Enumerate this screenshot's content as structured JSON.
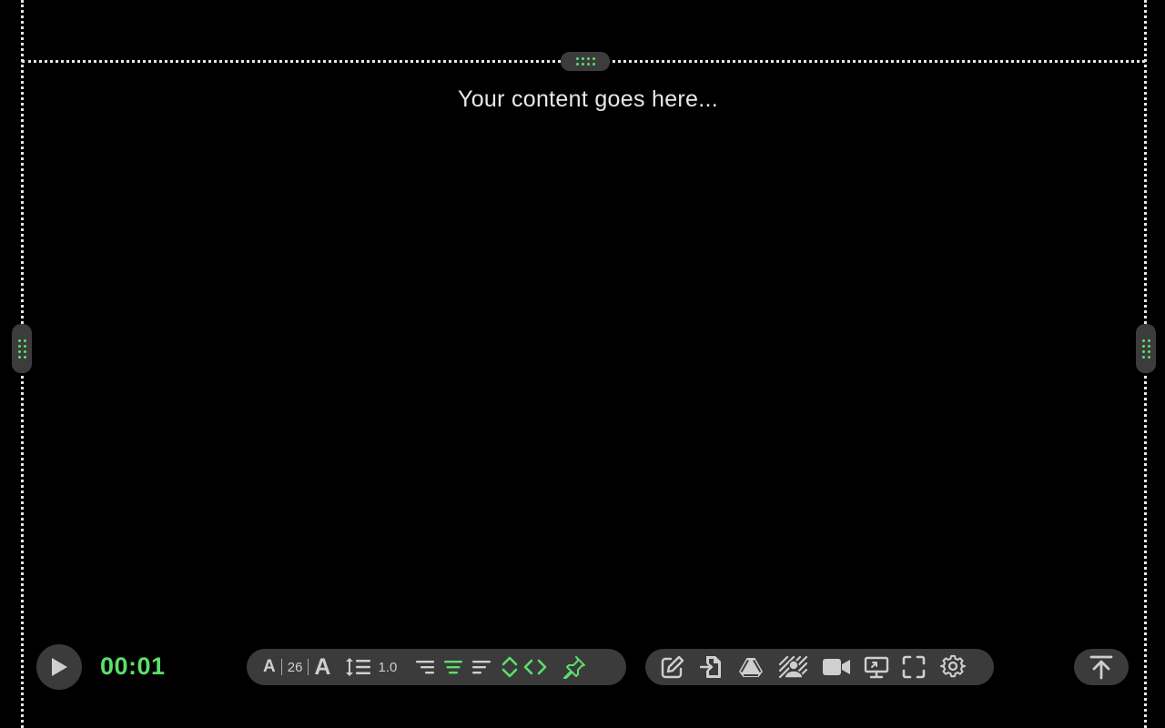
{
  "canvas": {
    "placeholder_text": "Your content goes here..."
  },
  "player": {
    "play_icon": "play-icon",
    "timer": "00:01"
  },
  "format_toolbar": {
    "font_decrease_label": "A",
    "font_size": "26",
    "font_increase_label": "A",
    "line_height_icon": "line-height-icon",
    "line_height": "1.0",
    "align_right_icon": "align-right-icon",
    "align_center_icon": "align-center-icon",
    "align_left_icon": "align-left-icon",
    "flip_vertical_icon": "flip-vertical-icon",
    "flip_horizontal_icon": "flip-horizontal-icon",
    "pin_icon": "pin-icon",
    "active_align": "center"
  },
  "tools_toolbar": {
    "items": [
      {
        "icon": "edit-icon"
      },
      {
        "icon": "import-file-icon"
      },
      {
        "icon": "google-drive-icon"
      },
      {
        "icon": "background-overlay-icon"
      },
      {
        "icon": "video-camera-icon"
      },
      {
        "icon": "screen-share-icon"
      },
      {
        "icon": "fullscreen-icon"
      },
      {
        "icon": "settings-gear-icon"
      }
    ]
  },
  "scroll_top": {
    "icon": "scroll-to-top-icon"
  },
  "colors": {
    "accent": "#5be06b",
    "toolbar_bg": "#3b3b3b",
    "icon": "#cfcfcf",
    "background": "#000000"
  }
}
